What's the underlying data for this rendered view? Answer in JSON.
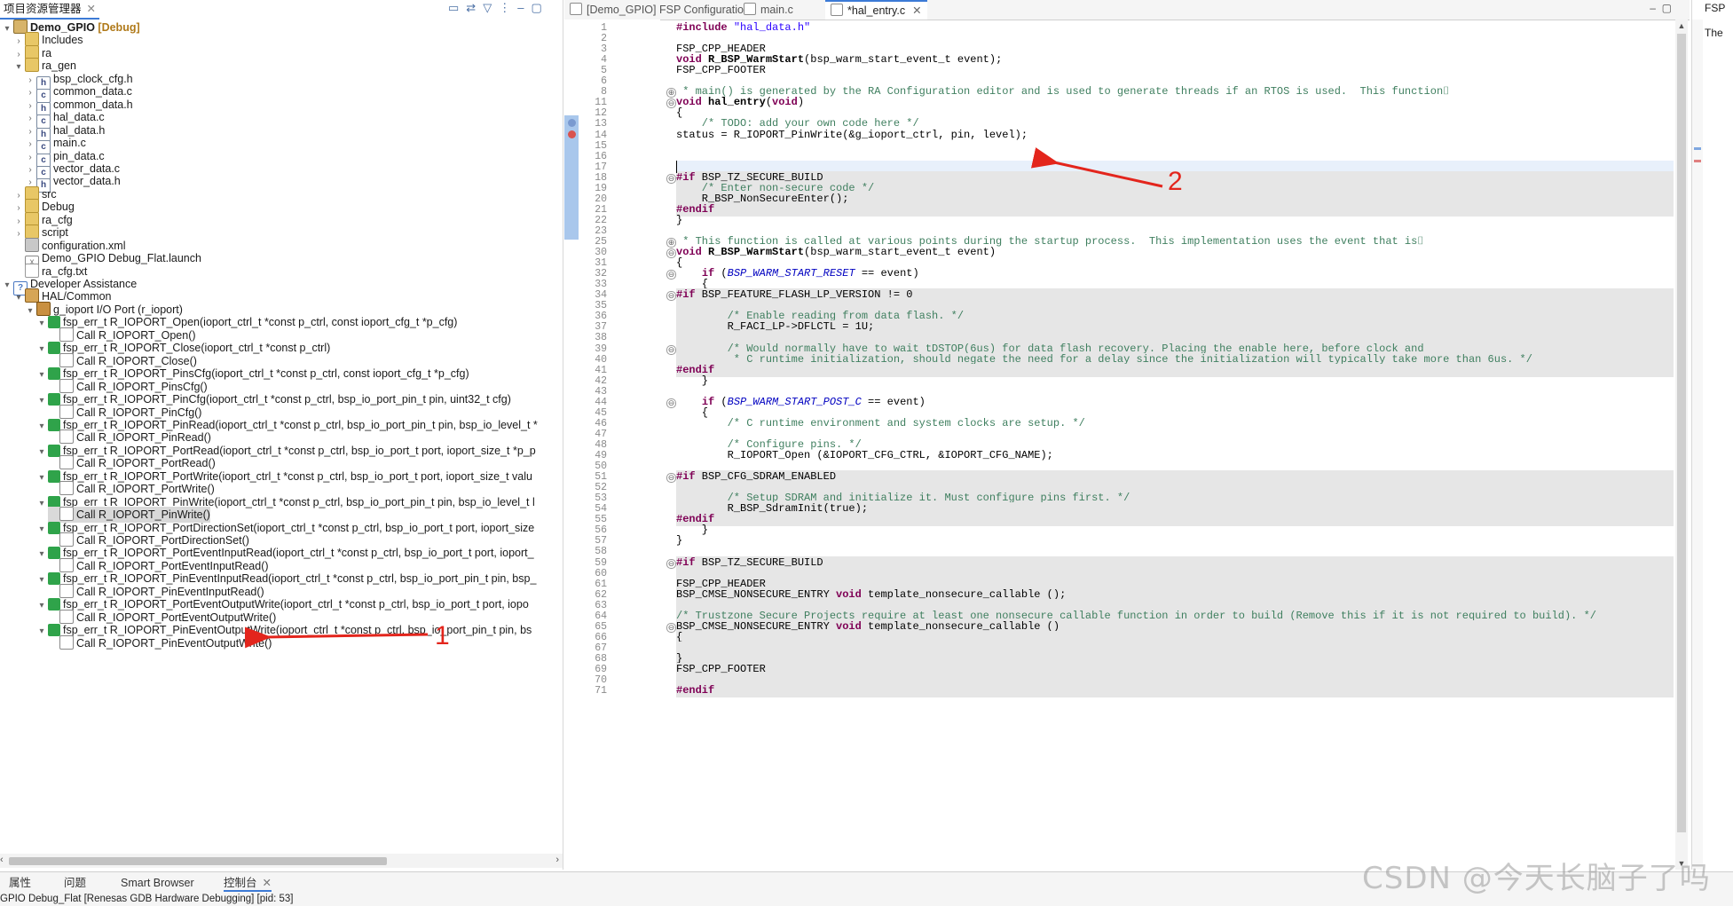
{
  "explorer": {
    "tab_label": "项目资源管理器",
    "tab_close": "✕",
    "items": [
      {
        "level": 0,
        "twisty": "▾",
        "icon": "project-icon",
        "label": "Demo_GPIO",
        "extra": "[Debug]"
      },
      {
        "level": 1,
        "twisty": "›",
        "icon": "includes-icon",
        "label": "Includes"
      },
      {
        "level": 1,
        "twisty": "›",
        "icon": "folder-icon",
        "label": "ra"
      },
      {
        "level": 1,
        "twisty": "▾",
        "icon": "folder-icon",
        "label": "ra_gen"
      },
      {
        "level": 2,
        "twisty": "›",
        "icon": "h-file-icon",
        "label": "bsp_clock_cfg.h"
      },
      {
        "level": 2,
        "twisty": "›",
        "icon": "c-file-icon",
        "label": "common_data.c"
      },
      {
        "level": 2,
        "twisty": "›",
        "icon": "h-file-icon",
        "label": "common_data.h"
      },
      {
        "level": 2,
        "twisty": "›",
        "icon": "c-file-icon",
        "label": "hal_data.c"
      },
      {
        "level": 2,
        "twisty": "›",
        "icon": "h-file-icon",
        "label": "hal_data.h"
      },
      {
        "level": 2,
        "twisty": "›",
        "icon": "c-file-icon",
        "label": "main.c"
      },
      {
        "level": 2,
        "twisty": "›",
        "icon": "c-file-icon",
        "label": "pin_data.c"
      },
      {
        "level": 2,
        "twisty": "›",
        "icon": "c-file-icon",
        "label": "vector_data.c"
      },
      {
        "level": 2,
        "twisty": "›",
        "icon": "h-file-icon",
        "label": "vector_data.h"
      },
      {
        "level": 1,
        "twisty": "›",
        "icon": "src-folder-icon",
        "label": "src"
      },
      {
        "level": 1,
        "twisty": "›",
        "icon": "folder-icon",
        "label": "Debug"
      },
      {
        "level": 1,
        "twisty": "›",
        "icon": "folder-icon",
        "label": "ra_cfg"
      },
      {
        "level": 1,
        "twisty": "›",
        "icon": "folder-icon",
        "label": "script"
      },
      {
        "level": 1,
        "twisty": "",
        "icon": "gear-icon",
        "label": "configuration.xml"
      },
      {
        "level": 1,
        "twisty": "",
        "icon": "launch-icon",
        "label": "Demo_GPIO Debug_Flat.launch"
      },
      {
        "level": 1,
        "twisty": "",
        "icon": "text-file-icon",
        "label": "ra_cfg.txt"
      },
      {
        "level": 0,
        "twisty": "▾",
        "icon": "help-icon",
        "label": "Developer Assistance"
      },
      {
        "level": 1,
        "twisty": "▾",
        "icon": "package-icon",
        "label": "HAL/Common"
      },
      {
        "level": 2,
        "twisty": "▾",
        "icon": "driver-icon",
        "label": "g_ioport I/O Port (r_ioport)"
      },
      {
        "level": 3,
        "twisty": "▾",
        "icon": "function-dot-icon",
        "label": "fsp_err_t R_IOPORT_Open(ioport_ctrl_t *const p_ctrl, const ioport_cfg_t *p_cfg)"
      },
      {
        "level": 4,
        "twisty": "",
        "icon": "call-icon",
        "label": "Call R_IOPORT_Open()"
      },
      {
        "level": 3,
        "twisty": "▾",
        "icon": "function-dot-icon",
        "label": "fsp_err_t R_IOPORT_Close(ioport_ctrl_t *const p_ctrl)"
      },
      {
        "level": 4,
        "twisty": "",
        "icon": "call-icon",
        "label": "Call R_IOPORT_Close()"
      },
      {
        "level": 3,
        "twisty": "▾",
        "icon": "function-dot-icon",
        "label": "fsp_err_t R_IOPORT_PinsCfg(ioport_ctrl_t *const p_ctrl, const ioport_cfg_t *p_cfg)"
      },
      {
        "level": 4,
        "twisty": "",
        "icon": "call-icon",
        "label": "Call R_IOPORT_PinsCfg()"
      },
      {
        "level": 3,
        "twisty": "▾",
        "icon": "function-dot-icon",
        "label": "fsp_err_t R_IOPORT_PinCfg(ioport_ctrl_t *const p_ctrl, bsp_io_port_pin_t pin, uint32_t cfg)"
      },
      {
        "level": 4,
        "twisty": "",
        "icon": "call-icon",
        "label": "Call R_IOPORT_PinCfg()"
      },
      {
        "level": 3,
        "twisty": "▾",
        "icon": "function-dot-icon",
        "label": "fsp_err_t R_IOPORT_PinRead(ioport_ctrl_t *const p_ctrl, bsp_io_port_pin_t pin, bsp_io_level_t *"
      },
      {
        "level": 4,
        "twisty": "",
        "icon": "call-icon",
        "label": "Call R_IOPORT_PinRead()"
      },
      {
        "level": 3,
        "twisty": "▾",
        "icon": "function-dot-icon",
        "label": "fsp_err_t R_IOPORT_PortRead(ioport_ctrl_t *const p_ctrl, bsp_io_port_t port, ioport_size_t *p_p"
      },
      {
        "level": 4,
        "twisty": "",
        "icon": "call-icon",
        "label": "Call R_IOPORT_PortRead()"
      },
      {
        "level": 3,
        "twisty": "▾",
        "icon": "function-dot-icon",
        "label": "fsp_err_t R_IOPORT_PortWrite(ioport_ctrl_t *const p_ctrl, bsp_io_port_t port, ioport_size_t valu"
      },
      {
        "level": 4,
        "twisty": "",
        "icon": "call-icon",
        "label": "Call R_IOPORT_PortWrite()"
      },
      {
        "level": 3,
        "twisty": "▾",
        "icon": "function-dot-icon",
        "label": "fsp_err_t R_IOPORT_PinWrite(ioport_ctrl_t *const p_ctrl, bsp_io_port_pin_t pin, bsp_io_level_t l"
      },
      {
        "level": 4,
        "twisty": "",
        "icon": "call-icon",
        "label": "Call R_IOPORT_PinWrite()",
        "selected": true
      },
      {
        "level": 3,
        "twisty": "▾",
        "icon": "function-dot-icon",
        "label": "fsp_err_t R_IOPORT_PortDirectionSet(ioport_ctrl_t *const p_ctrl, bsp_io_port_t port, ioport_size"
      },
      {
        "level": 4,
        "twisty": "",
        "icon": "call-icon",
        "label": "Call R_IOPORT_PortDirectionSet()"
      },
      {
        "level": 3,
        "twisty": "▾",
        "icon": "function-dot-icon",
        "label": "fsp_err_t R_IOPORT_PortEventInputRead(ioport_ctrl_t *const p_ctrl, bsp_io_port_t port, ioport_"
      },
      {
        "level": 4,
        "twisty": "",
        "icon": "call-icon",
        "label": "Call R_IOPORT_PortEventInputRead()"
      },
      {
        "level": 3,
        "twisty": "▾",
        "icon": "function-dot-icon",
        "label": "fsp_err_t R_IOPORT_PinEventInputRead(ioport_ctrl_t *const p_ctrl, bsp_io_port_pin_t pin, bsp_"
      },
      {
        "level": 4,
        "twisty": "",
        "icon": "call-icon",
        "label": "Call R_IOPORT_PinEventInputRead()"
      },
      {
        "level": 3,
        "twisty": "▾",
        "icon": "function-dot-icon",
        "label": "fsp_err_t R_IOPORT_PortEventOutputWrite(ioport_ctrl_t *const p_ctrl, bsp_io_port_t port, iopo"
      },
      {
        "level": 4,
        "twisty": "",
        "icon": "call-icon",
        "label": "Call R_IOPORT_PortEventOutputWrite()"
      },
      {
        "level": 3,
        "twisty": "▾",
        "icon": "function-dot-icon",
        "label": "fsp_err_t R_IOPORT_PinEventOutputWrite(ioport_ctrl_t *const p_ctrl, bsp_io_port_pin_t pin, bs"
      },
      {
        "level": 4,
        "twisty": "",
        "icon": "call-icon",
        "label": "Call R_IOPORT_PinEventOutputWrite()"
      }
    ]
  },
  "editor": {
    "tabs": [
      {
        "label": "[Demo_GPIO] FSP Configuration",
        "active": false
      },
      {
        "label": "main.c",
        "active": false
      },
      {
        "label": "*hal_entry.c",
        "active": true
      }
    ],
    "lines": [
      {
        "n": "1",
        "t": "#include \"hal_data.h\"",
        "k": "inc"
      },
      {
        "n": "2",
        "t": ""
      },
      {
        "n": "3",
        "t": "FSP_CPP_HEADER"
      },
      {
        "n": "4",
        "t": "void R_BSP_WarmStart(bsp_warm_start_event_t event);",
        "k": "decl"
      },
      {
        "n": "5",
        "t": "FSP_CPP_FOOTER"
      },
      {
        "n": "6",
        "t": ""
      },
      {
        "n": "8",
        "t": " * main() is generated by the RA Configuration editor and is used to generate threads if an RTOS is used.  This function⌷",
        "k": "cm",
        "fold": "⊕"
      },
      {
        "n": "11",
        "t": "void hal_entry(void)",
        "k": "fndef",
        "fold": "⊖"
      },
      {
        "n": "12",
        "t": "{"
      },
      {
        "n": "13",
        "t": "    /* TODO: add your own code here */",
        "k": "cm"
      },
      {
        "n": "14",
        "t": "status = R_IOPORT_PinWrite(&g_ioport_ctrl, pin, level);",
        "k": "stmt"
      },
      {
        "n": "15",
        "t": ""
      },
      {
        "n": "16",
        "t": ""
      },
      {
        "n": "17",
        "t": "",
        "cur": true
      },
      {
        "n": "18",
        "t": "#if BSP_TZ_SECURE_BUILD",
        "k": "pp",
        "grey": true,
        "fold": "⊖"
      },
      {
        "n": "19",
        "t": "    /* Enter non-secure code */",
        "k": "cm",
        "grey": true
      },
      {
        "n": "20",
        "t": "    R_BSP_NonSecureEnter();",
        "grey": true
      },
      {
        "n": "21",
        "t": "#endif",
        "k": "pp",
        "grey": true
      },
      {
        "n": "22",
        "t": "}"
      },
      {
        "n": "23",
        "t": ""
      },
      {
        "n": "25",
        "t": " * This function is called at various points during the startup process.  This implementation uses the event that is⌷",
        "k": "cm",
        "fold": "⊕"
      },
      {
        "n": "30",
        "t": "void R_BSP_WarmStart(bsp_warm_start_event_t event)",
        "k": "fndef2",
        "fold": "⊖"
      },
      {
        "n": "31",
        "t": "{"
      },
      {
        "n": "32",
        "t": "    if (BSP_WARM_START_RESET == event)",
        "k": "if1",
        "fold": "⊖"
      },
      {
        "n": "33",
        "t": "    {"
      },
      {
        "n": "34",
        "t": "#if BSP_FEATURE_FLASH_LP_VERSION != 0",
        "k": "pp",
        "grey": true,
        "fold": "⊖"
      },
      {
        "n": "35",
        "t": "",
        "grey": true
      },
      {
        "n": "36",
        "t": "        /* Enable reading from data flash. */",
        "k": "cm",
        "grey": true
      },
      {
        "n": "37",
        "t": "        R_FACI_LP->DFLCTL = 1U;",
        "grey": true
      },
      {
        "n": "38",
        "t": "",
        "grey": true
      },
      {
        "n": "39",
        "t": "        /* Would normally have to wait tDSTOP(6us) for data flash recovery. Placing the enable here, before clock and",
        "k": "cm",
        "grey": true,
        "fold": "⊖"
      },
      {
        "n": "40",
        "t": "         * C runtime initialization, should negate the need for a delay since the initialization will typically take more than 6us. */",
        "k": "cm",
        "grey": true
      },
      {
        "n": "41",
        "t": "#endif",
        "k": "pp",
        "grey": true
      },
      {
        "n": "42",
        "t": "    }"
      },
      {
        "n": "43",
        "t": ""
      },
      {
        "n": "44",
        "t": "    if (BSP_WARM_START_POST_C == event)",
        "k": "if2",
        "fold": "⊖"
      },
      {
        "n": "45",
        "t": "    {"
      },
      {
        "n": "46",
        "t": "        /* C runtime environment and system clocks are setup. */",
        "k": "cm"
      },
      {
        "n": "47",
        "t": ""
      },
      {
        "n": "48",
        "t": "        /* Configure pins. */",
        "k": "cm"
      },
      {
        "n": "49",
        "t": "        R_IOPORT_Open (&IOPORT_CFG_CTRL, &IOPORT_CFG_NAME);"
      },
      {
        "n": "50",
        "t": ""
      },
      {
        "n": "51",
        "t": "#if BSP_CFG_SDRAM_ENABLED",
        "k": "pp",
        "grey": true,
        "fold": "⊖"
      },
      {
        "n": "52",
        "t": "",
        "grey": true
      },
      {
        "n": "53",
        "t": "        /* Setup SDRAM and initialize it. Must configure pins first. */",
        "k": "cm",
        "grey": true
      },
      {
        "n": "54",
        "t": "        R_BSP_SdramInit(true);",
        "grey": true
      },
      {
        "n": "55",
        "t": "#endif",
        "k": "pp",
        "grey": true
      },
      {
        "n": "56",
        "t": "    }"
      },
      {
        "n": "57",
        "t": "}"
      },
      {
        "n": "58",
        "t": ""
      },
      {
        "n": "59",
        "t": "#if BSP_TZ_SECURE_BUILD",
        "k": "pp",
        "grey": true,
        "fold": "⊖"
      },
      {
        "n": "60",
        "t": "",
        "grey": true
      },
      {
        "n": "61",
        "t": "FSP_CPP_HEADER",
        "grey": true
      },
      {
        "n": "62",
        "t": "BSP_CMSE_NONSECURE_ENTRY void template_nonsecure_callable ();",
        "k": "cmse",
        "grey": true
      },
      {
        "n": "63",
        "t": "",
        "grey": true
      },
      {
        "n": "64",
        "t": "/* Trustzone Secure Projects require at least one nonsecure callable function in order to build (Remove this if it is not required to build). */",
        "k": "cm",
        "grey": true
      },
      {
        "n": "65",
        "t": "BSP_CMSE_NONSECURE_ENTRY void template_nonsecure_callable ()",
        "k": "cmse",
        "grey": true,
        "fold": "⊖"
      },
      {
        "n": "66",
        "t": "{",
        "grey": true
      },
      {
        "n": "67",
        "t": "",
        "grey": true
      },
      {
        "n": "68",
        "t": "}",
        "grey": true
      },
      {
        "n": "69",
        "t": "FSP_CPP_FOOTER",
        "grey": true
      },
      {
        "n": "70",
        "t": "",
        "grey": true
      },
      {
        "n": "71",
        "t": "#endif",
        "k": "pp",
        "grey": true
      }
    ]
  },
  "right_pane": {
    "tab_label": "FSP",
    "text": "The"
  },
  "bottom": {
    "tabs": [
      {
        "label": "属性",
        "active": false
      },
      {
        "label": "问题",
        "active": false
      },
      {
        "label": "Smart Browser",
        "active": false
      },
      {
        "label": "控制台",
        "active": true
      }
    ],
    "console_text": "GPIO Debug_Flat [Renesas GDB Hardware Debugging] [pid: 53]"
  },
  "annotations": {
    "arrow1_label": "1",
    "arrow2_label": "2",
    "arrow_color": "#e3251c"
  },
  "watermark": "CSDN @今天长脑子了吗"
}
